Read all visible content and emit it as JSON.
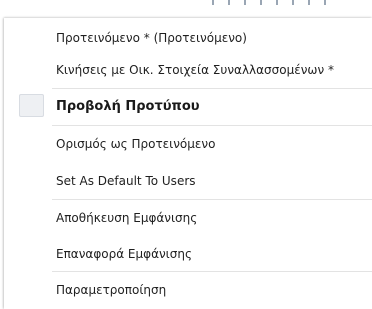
{
  "menu": {
    "items": [
      {
        "label": "Προτεινόμενο * (Προτεινόμενο)"
      },
      {
        "label": "Κινήσεις με Οικ. Στοιχεία Συναλλασσομένων *"
      },
      {
        "label": "Προβολή Προτύπου",
        "checked": true
      },
      {
        "label": "Ορισμός ως Προτεινόμενο"
      },
      {
        "label": "Set As Default To Users"
      },
      {
        "label": "Αποθήκευση Εμφάνισης"
      },
      {
        "label": "Επαναφορά Εμφάνισης"
      },
      {
        "label": "Παραμετροποίηση"
      }
    ]
  },
  "colors": {
    "menu_background": "#ffffff",
    "separator": "#e3e3e3",
    "checkbox_fill": "#eef0f3"
  }
}
